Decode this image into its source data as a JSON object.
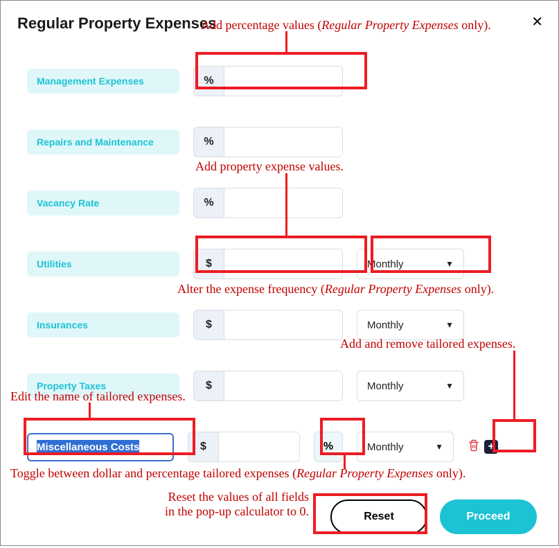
{
  "title": "Regular Property Expenses",
  "rows": {
    "management": {
      "label": "Management Expenses",
      "prefix": "%"
    },
    "repairs": {
      "label": "Repairs and Maintenance",
      "prefix": "%"
    },
    "vacancy": {
      "label": "Vacancy Rate",
      "prefix": "%"
    },
    "utilities": {
      "label": "Utilities",
      "prefix": "$",
      "frequency": "Monthly"
    },
    "insurances": {
      "label": "Insurances",
      "prefix": "$",
      "frequency": "Monthly"
    },
    "property_taxes": {
      "label": "Property Taxes",
      "prefix": "$",
      "frequency": "Monthly"
    },
    "misc": {
      "name": "Miscellaneous Costs",
      "prefix": "$",
      "toggle": "%",
      "frequency": "Monthly"
    }
  },
  "buttons": {
    "reset": "Reset",
    "proceed": "Proceed"
  },
  "annotations": {
    "a1": "Add percentage values (",
    "a1_i": "Regular Property Expenses",
    "a1_end": " only).",
    "a2": "Add property expense values.",
    "a3": "Alter the expense frequency (",
    "a3_i": "Regular Property Expenses",
    "a3_end": " only).",
    "a4": "Add and remove tailored expenses.",
    "a5": "Edit the name of tailored expenses.",
    "a6": "Toggle between dollar and percentage tailored expenses (",
    "a6_i": "Regular Property Expenses",
    "a6_end": " only).",
    "a7a": "Reset the values of all fields",
    "a7b": "in the pop-up calculator to 0."
  }
}
